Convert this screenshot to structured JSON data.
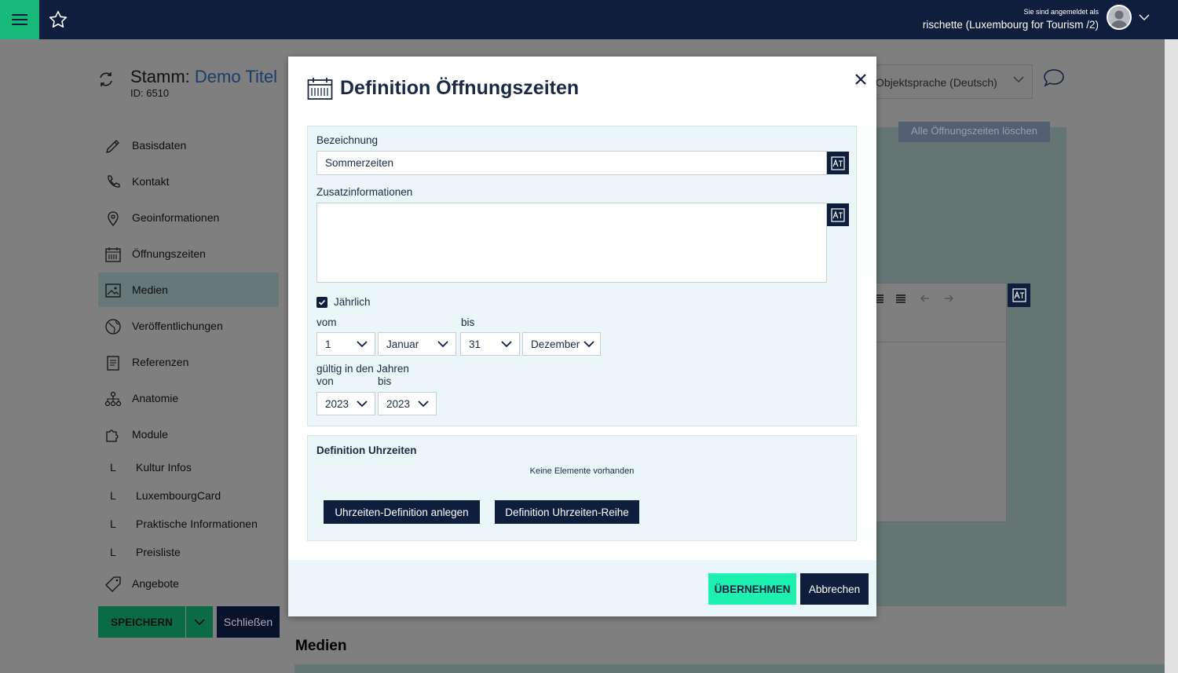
{
  "topbar": {
    "menu_icon": "hamburger-icon",
    "favorite_icon": "star-icon",
    "login_label": "Sie sind angemeldet als",
    "user_name": "rischette (Luxembourg for Tourism /2)",
    "user_menu_icon": "chevron-down-icon"
  },
  "header": {
    "title_prefix": "Stamm:",
    "title_name": "Demo Titel",
    "id_label": "ID: 6510",
    "language_select": "Objektsprache (Deutsch)"
  },
  "sidebar": {
    "items": [
      {
        "label": "Basisdaten",
        "icon": "pencil-icon"
      },
      {
        "label": "Kontakt",
        "icon": "phone-icon"
      },
      {
        "label": "Geoinformationen",
        "icon": "map-pin-icon"
      },
      {
        "label": "Öffnungszeiten",
        "icon": "calendar-icon"
      },
      {
        "label": "Medien",
        "icon": "image-icon",
        "active": true
      },
      {
        "label": "Veröffentlichungen",
        "icon": "globe-icon"
      },
      {
        "label": "Referenzen",
        "icon": "references-icon"
      },
      {
        "label": "Anatomie",
        "icon": "hierarchy-icon"
      },
      {
        "label": "Module",
        "icon": "puzzle-icon"
      }
    ],
    "sub_items": [
      {
        "marker": "L",
        "label": "Kultur Infos"
      },
      {
        "marker": "L",
        "label": "LuxembourgCard"
      },
      {
        "marker": "L",
        "label": "Praktische Informationen"
      },
      {
        "marker": "L",
        "label": "Preisliste"
      }
    ],
    "last_item": {
      "label": "Angebote",
      "icon": "tag-icon"
    }
  },
  "actions": {
    "save": "SPEICHERN",
    "close": "Schließen"
  },
  "background": {
    "delete_all": "Alle Öffnungszeiten löschen",
    "section_heading": "Medien"
  },
  "modal": {
    "title": "Definition Öffnungszeiten",
    "name_label": "Bezeichnung",
    "name_value": "Sommerzeiten",
    "info_label": "Zusatzinformationen",
    "info_value": "",
    "yearly_label": "Jährlich",
    "yearly_checked": true,
    "from_label": "vom",
    "to_label": "bis",
    "from_day": "1",
    "from_month": "Januar",
    "to_day": "31",
    "to_month": "Dezember",
    "years_label": "gültig in den Jahren",
    "years_from_label": "von",
    "years_to_label": "bis",
    "year_from": "2023",
    "year_to": "2023",
    "times_heading": "Definition Uhrzeiten",
    "empty_text": "Keine Elemente vorhanden",
    "create_time_button": "Uhrzeiten-Definition anlegen",
    "time_series_button": "Definition Uhrzeiten-Reihe",
    "apply_button": "ÜBERNEHMEN",
    "cancel_button": "Abbrechen"
  },
  "colors": {
    "navy": "#0f1e3d",
    "green": "#17b978",
    "mint": "#1ef0b0",
    "section_bg": "#eaf6f7"
  }
}
